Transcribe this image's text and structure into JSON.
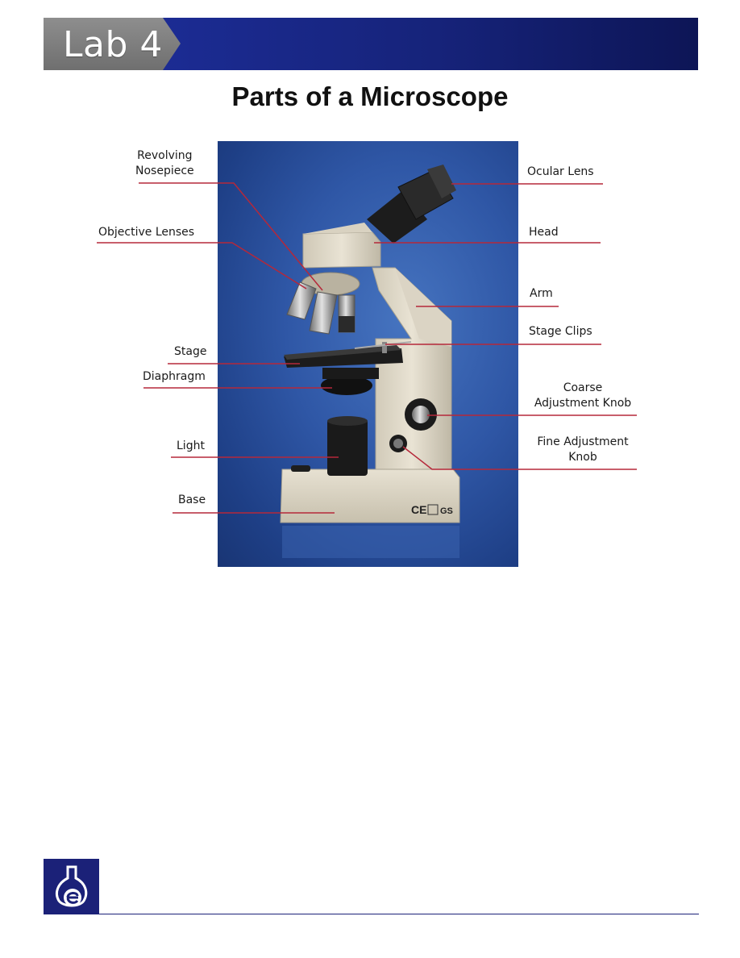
{
  "header": {
    "lab_label": "Lab 4"
  },
  "title": "Parts of a Microscope",
  "diagram": {
    "labels_left": [
      {
        "id": "revolving-nosepiece",
        "text": "Revolving\nNosepiece"
      },
      {
        "id": "objective-lenses",
        "text": "Objective Lenses"
      },
      {
        "id": "stage",
        "text": "Stage"
      },
      {
        "id": "diaphragm",
        "text": "Diaphragm"
      },
      {
        "id": "light",
        "text": "Light"
      },
      {
        "id": "base",
        "text": "Base"
      }
    ],
    "labels_right": [
      {
        "id": "ocular-lens",
        "text": "Ocular Lens"
      },
      {
        "id": "head",
        "text": "Head"
      },
      {
        "id": "arm",
        "text": "Arm"
      },
      {
        "id": "stage-clips",
        "text": "Stage Clips"
      },
      {
        "id": "coarse-adjustment-knob",
        "text": "Coarse\nAdjustment Knob"
      },
      {
        "id": "fine-adjustment-knob",
        "text": "Fine Adjustment\nKnob"
      }
    ],
    "leader_color": "#b5283a",
    "markings": {
      "ce": "CE",
      "gs": "GS"
    }
  },
  "colors": {
    "header_blue": "#1b2a8e",
    "tab_gray": "#7d7d7d",
    "background_blue": "#2f57a6"
  }
}
